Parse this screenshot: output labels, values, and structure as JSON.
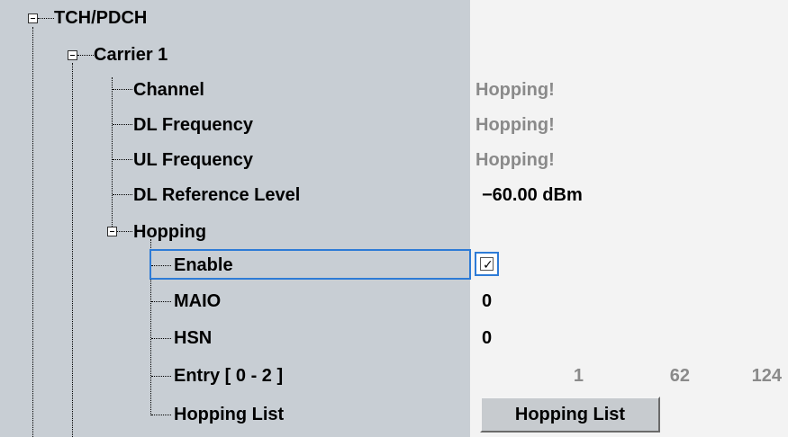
{
  "tree": {
    "root": {
      "label": "TCH/PDCH"
    },
    "carrier": {
      "label": "Carrier 1"
    },
    "channel": {
      "label": "Channel",
      "value": "Hopping!"
    },
    "dl_frequency": {
      "label": "DL Frequency",
      "value": "Hopping!"
    },
    "ul_frequency": {
      "label": "UL Frequency",
      "value": "Hopping!"
    },
    "dl_reference_level": {
      "label": "DL Reference Level",
      "value": "−60.00 dBm"
    },
    "hopping": {
      "label": "Hopping",
      "enable": {
        "label": "Enable",
        "checked": true,
        "check_glyph": "✓"
      },
      "maio": {
        "label": "MAIO",
        "value": "0"
      },
      "hsn": {
        "label": "HSN",
        "value": "0"
      },
      "entry": {
        "label": "Entry [ 0 - 2 ]",
        "values": [
          "1",
          "62",
          "124"
        ]
      },
      "hopping_list": {
        "label": "Hopping List",
        "button_label": "Hopping List"
      }
    }
  },
  "colors": {
    "tree_background": "#c8ced4",
    "value_background": "#f3f3f3",
    "focus": "#2e7bd6",
    "inactive_text": "#8a8a8a"
  }
}
